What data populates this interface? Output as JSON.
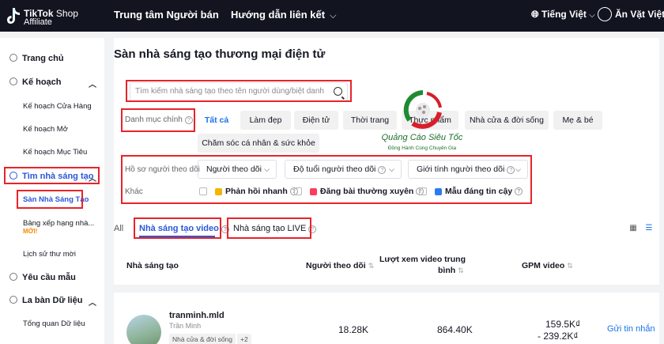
{
  "header": {
    "logo_line1_bold": "TikTok",
    "logo_line1_rest": " Shop",
    "logo_line2": "Affiliate",
    "nav_seller_center": "Trung tâm Người bán",
    "nav_link_guide": "Hướng dẫn liên kết",
    "language": "Tiếng Việt",
    "shop_name": "Ăn Vặt Việt"
  },
  "sidebar": {
    "home": "Trang chủ",
    "plan": "Kế hoạch",
    "plan_shop": "Kế hoạch Cửa Hàng",
    "plan_open": "Kế hoạch Mở",
    "plan_target": "Kế hoạch Mục Tiêu",
    "find_creators": "Tìm nhà sáng tạo",
    "creator_marketplace": "Sàn Nhà Sáng Tạo",
    "ranking": "Bảng xếp hạng nhà...",
    "ranking_badge": "MỚI!",
    "invite_history": "Lịch sử thư mời",
    "sample_requests": "Yêu cầu mẫu",
    "data_compass": "La bàn Dữ liệu",
    "data_overview": "Tổng quan Dữ liệu"
  },
  "main": {
    "title": "Sàn nhà sáng tạo thương mại điện tử",
    "search_placeholder": "Tìm kiếm nhà sáng tạo theo tên người dùng/biệt danh",
    "category_label": "Danh mục chính",
    "categories": [
      "Tất cả",
      "Làm đẹp",
      "Điện tử",
      "Thời trang",
      "Thực phẩm",
      "Nhà cửa & đời sống",
      "Mẹ & bé",
      "Chăm sóc cá nhân & sức khỏe"
    ],
    "follower_profile_label": "Hồ sơ người theo dõi",
    "filter_followers": "Người theo dõi",
    "filter_age": "Độ tuổi người theo dõi",
    "filter_gender": "Giới tính người theo dõi",
    "other_label": "Khác",
    "cb_quick_reply": "Phản hồi nhanh",
    "cb_frequent_post": "Đăng bài thường xuyên",
    "cb_trusted": "Mẫu đáng tin cậy",
    "tab_all": "All",
    "tab_video": "Nhà sáng tạo video",
    "tab_live": "Nhà sáng tạo LIVE",
    "col_creator": "Nhà sáng tạo",
    "col_followers": "Người theo dõi",
    "col_avg_views_l1": "Lượt xem video trung",
    "col_avg_views_l2": "bình",
    "col_gpm": "GPM video",
    "row": {
      "username": "tranminh.mld",
      "display_name": "Trần Minh",
      "tag": "Nhà cửa & đời sống",
      "tag_more": "+2",
      "followers": "18.28K",
      "avg_views": "864.40K",
      "gpm_l1": "159.5K₫",
      "gpm_l2": "- 239.2K₫",
      "contact": "Gửi tin nhắn"
    }
  },
  "watermark": {
    "text": "Quảng Cáo Siêu Tốc",
    "sub": "Đồng Hành Cùng Chuyên Gia"
  },
  "colors": {
    "accent": "#1a73e8",
    "annotation_red": "#e8232a",
    "topbar": "#121420"
  }
}
